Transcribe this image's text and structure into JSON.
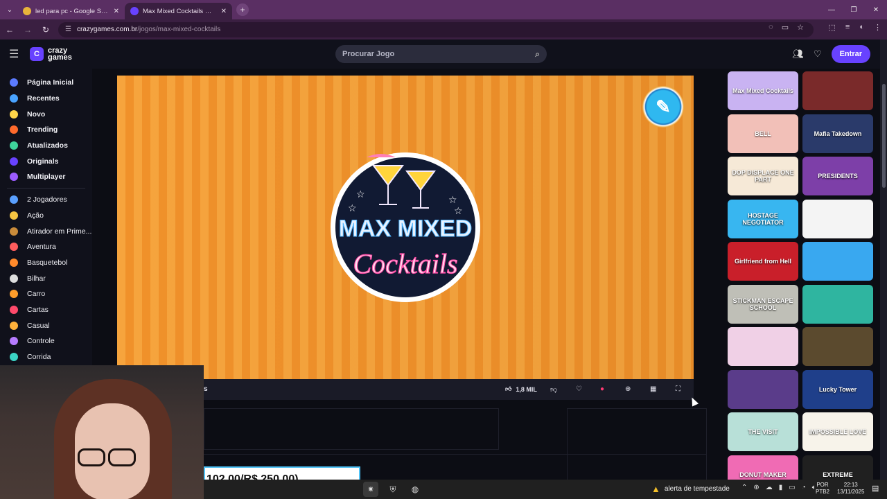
{
  "browser": {
    "tabs": [
      {
        "title": "led para pc - Google Shopping",
        "active": false,
        "favicon_color": "#e8b43b"
      },
      {
        "title": "Max Mixed Cocktails 🕹️ Jogue",
        "active": true,
        "favicon_color": "#6842ff"
      }
    ],
    "new_tab": "+",
    "url_host": "crazygames.com.br",
    "url_path": "/jogos/max-mixed-cocktails",
    "window_controls": [
      "—",
      "❐",
      "✕"
    ]
  },
  "site": {
    "logo_mark": "C",
    "logo_line1": "crazy",
    "logo_line2": "games",
    "search_placeholder": "Procurar Jogo",
    "login_label": "Entrar",
    "accent": "#6842ff"
  },
  "sidebar": {
    "primary": [
      {
        "label": "Página Inicial",
        "icon": "home-icon",
        "color": "#5b7bff"
      },
      {
        "label": "Recentes",
        "icon": "clock-icon",
        "color": "#49a3ff"
      },
      {
        "label": "Novo",
        "icon": "sparkle-icon",
        "color": "#ffd54a"
      },
      {
        "label": "Trending",
        "icon": "fire-icon",
        "color": "#ff6a2c"
      },
      {
        "label": "Atualizados",
        "icon": "refresh-icon",
        "color": "#3fd39b"
      },
      {
        "label": "Originals",
        "icon": "crazygames-icon",
        "color": "#6842ff"
      },
      {
        "label": "Multiplayer",
        "icon": "people-icon",
        "color": "#9c5cff"
      }
    ],
    "categories": [
      {
        "label": "2 Jogadores",
        "icon": "two-players-icon",
        "color": "#5aa0ff"
      },
      {
        "label": "Ação",
        "icon": "sword-icon",
        "color": "#f5c542"
      },
      {
        "label": "Atirador em Prime...",
        "icon": "gun-icon",
        "color": "#c98b3a"
      },
      {
        "label": "Aventura",
        "icon": "compass-icon",
        "color": "#ff5d5d"
      },
      {
        "label": "Basquetebol",
        "icon": "basketball-icon",
        "color": "#ff8a2b"
      },
      {
        "label": "Bilhar",
        "icon": "pool-ball-icon",
        "color": "#dddddd"
      },
      {
        "label": "Carro",
        "icon": "car-icon",
        "color": "#ff9d2b"
      },
      {
        "label": "Cartas",
        "icon": "cards-icon",
        "color": "#ff4a6b"
      },
      {
        "label": "Casual",
        "icon": "casual-icon",
        "color": "#ffb13b"
      },
      {
        "label": "Controle",
        "icon": "gamepad-icon",
        "color": "#b67bff"
      },
      {
        "label": "Corrida",
        "icon": "flag-icon",
        "color": "#3bd3c4"
      }
    ]
  },
  "game": {
    "title_partial": "s",
    "likes": "1,8 MIL",
    "game_logo_line1": "MAX MIXED",
    "game_logo_line2": "Cocktails"
  },
  "recommended": [
    {
      "label": "Max Mixed Cocktails",
      "bg": "#c9b3f2"
    },
    {
      "label": "",
      "bg": "#7a2a2a"
    },
    {
      "label": "BELL",
      "bg": "#f2c0b8"
    },
    {
      "label": "Mafia Takedown",
      "bg": "#2a3a6a"
    },
    {
      "label": "DOP DISPLACE ONE PART",
      "bg": "#f6e9d7"
    },
    {
      "label": "PRESIDENTS",
      "bg": "#7d3fa8"
    },
    {
      "label": "HOSTAGE NEGOTIATOR",
      "bg": "#38b6f0"
    },
    {
      "label": "",
      "bg": "#f4f4f4"
    },
    {
      "label": "Girlfriend from Hell",
      "bg": "#c91f2a"
    },
    {
      "label": "",
      "bg": "#39a8f0"
    },
    {
      "label": "STICKMAN ESCAPE SCHOOL",
      "bg": "#bfbfb7"
    },
    {
      "label": "",
      "bg": "#2fb5a0"
    },
    {
      "label": "",
      "bg": "#f0d0e6"
    },
    {
      "label": "",
      "bg": "#5b4a2e"
    },
    {
      "label": "",
      "bg": "#5a3c8a"
    },
    {
      "label": "Lucky Tower",
      "bg": "#1f3f8a"
    },
    {
      "label": "THE VISIT",
      "bg": "#b8e0d8"
    },
    {
      "label": "IMPOSSIBLE LOVE",
      "bg": "#f7f3ea"
    },
    {
      "label": "DONUT MAKER",
      "bg": "#f06bb4"
    },
    {
      "label": "EXTREME",
      "bg": "#202020"
    }
  ],
  "overlay": {
    "price_text": "102,00/R$ 250,00)"
  },
  "taskbar": {
    "weather_text": "alerta de tempestade",
    "lang_line1": "POR",
    "lang_line2": "PTB2",
    "time": "22:13",
    "date": "13/11/2025"
  }
}
